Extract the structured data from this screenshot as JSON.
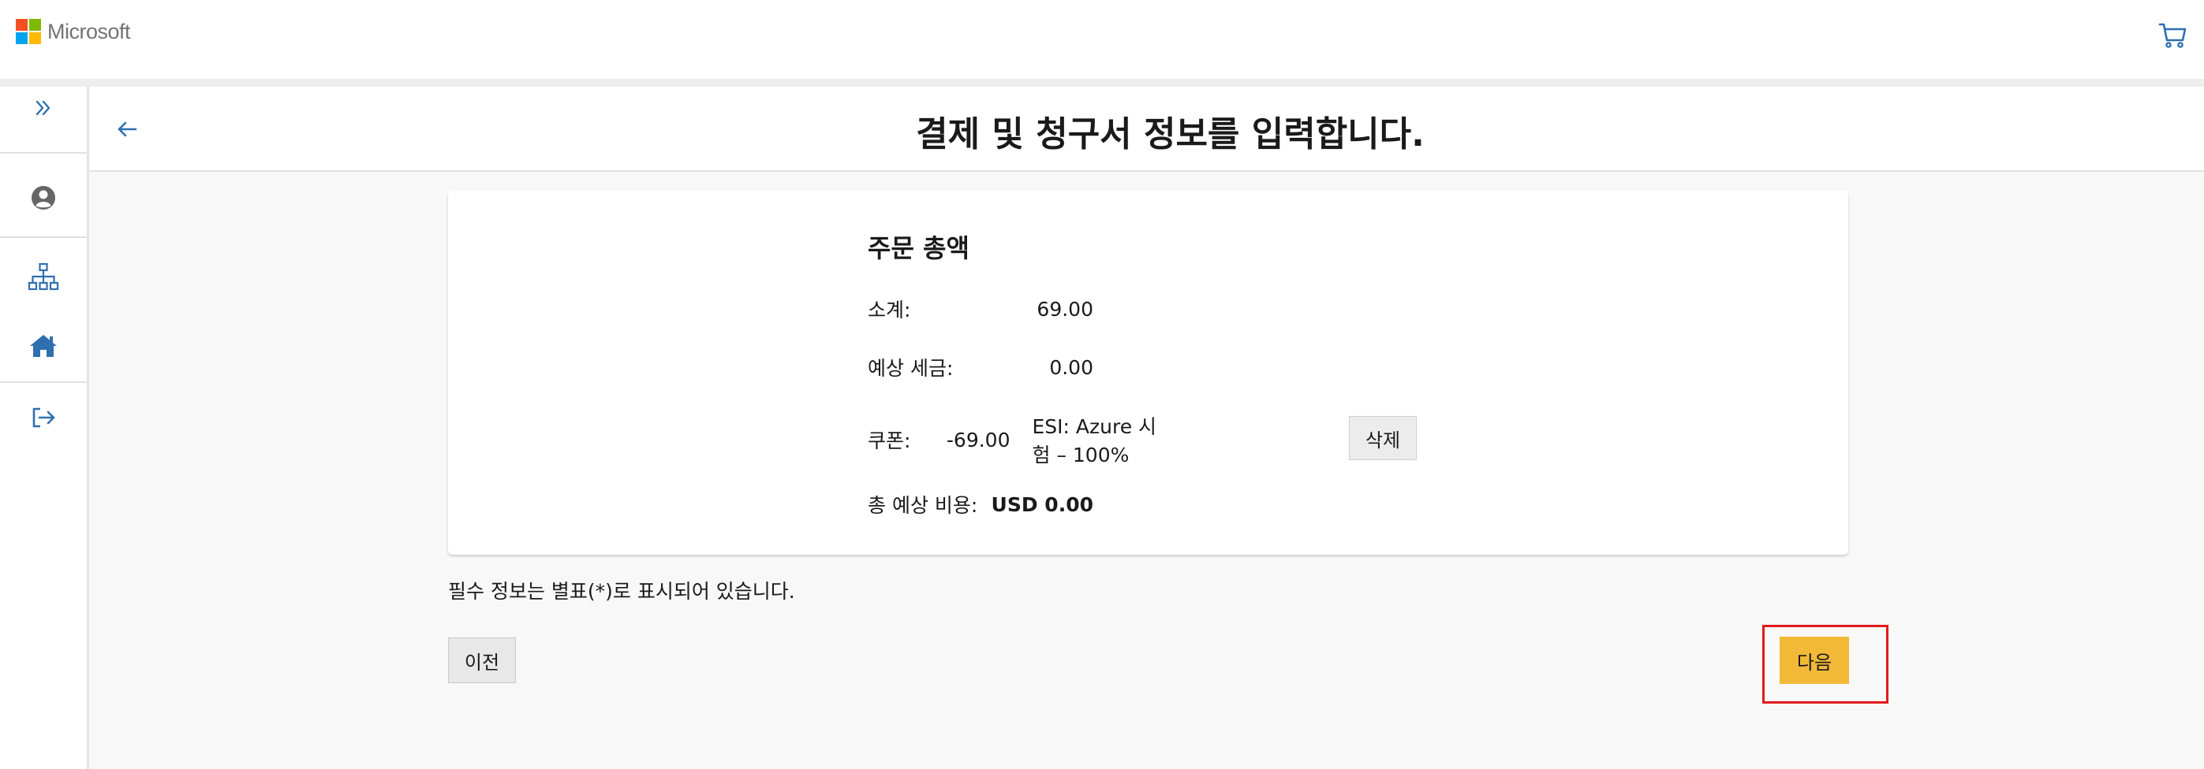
{
  "header": {
    "brand": "Microsoft",
    "brand_colors": [
      "#f25022",
      "#7fba00",
      "#00a4ef",
      "#ffb900"
    ],
    "cart_icon": "shopping-cart-icon"
  },
  "rail": {
    "items": [
      {
        "icon": "double-chevron-right-icon"
      },
      {
        "icon": "user-circle-icon"
      },
      {
        "icon": "org-hierarchy-icon"
      },
      {
        "icon": "home-icon"
      },
      {
        "icon": "sign-out-icon"
      }
    ]
  },
  "page": {
    "title": "결제 및 청구서 정보를 입력합니다.",
    "back_icon": "arrow-left-icon"
  },
  "order": {
    "title": "주문 총액",
    "subtotal_label": "소계:",
    "subtotal_value": "69.00",
    "tax_label": "예상 세금:",
    "tax_value": "0.00",
    "coupon_label": "쿠폰:",
    "coupon_value": "-69.00",
    "coupon_name": "ESI: Azure 시험 – 100%",
    "delete_label": "삭제",
    "total_label": "총 예상 비용:",
    "total_value": "USD 0.00"
  },
  "required_note": "필수 정보는 별표(*)로 표시되어 있습니다.",
  "buttons": {
    "prev": "이전",
    "next": "다음"
  },
  "colors": {
    "accent_blue": "#2f6fb0",
    "next_button": "#f2b937",
    "highlight": "#e21a1a"
  }
}
